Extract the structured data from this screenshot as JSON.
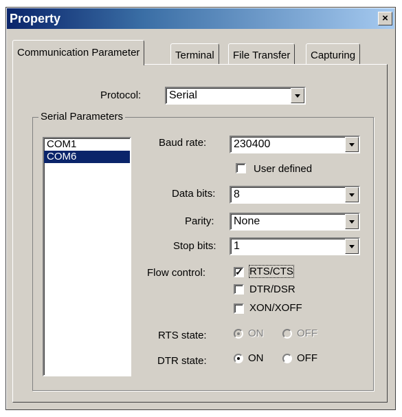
{
  "window": {
    "title": "Property",
    "close_glyph": "×"
  },
  "tabs": [
    {
      "label": "Communication Parameter",
      "active": true
    },
    {
      "label": "Terminal"
    },
    {
      "label": "File Transfer"
    },
    {
      "label": "Capturing"
    }
  ],
  "protocol": {
    "label": "Protocol:",
    "value": "Serial"
  },
  "serial_parameters": {
    "title": "Serial Parameters",
    "ports": [
      "COM1",
      "COM6"
    ],
    "selected_port": "COM6",
    "baud_rate": {
      "label": "Baud rate:",
      "value": "230400"
    },
    "user_defined": {
      "label": "User defined",
      "checked": false
    },
    "data_bits": {
      "label": "Data bits:",
      "value": "8"
    },
    "parity": {
      "label": "Parity:",
      "value": "None"
    },
    "stop_bits": {
      "label": "Stop bits:",
      "value": "1"
    },
    "flow_control": {
      "label": "Flow control:",
      "options": [
        {
          "label": "RTS/CTS",
          "checked": true
        },
        {
          "label": "DTR/DSR",
          "checked": false
        },
        {
          "label": "XON/XOFF",
          "checked": false
        }
      ]
    },
    "rts_state": {
      "label": "RTS state:",
      "on": "ON",
      "off": "OFF",
      "value": "ON",
      "enabled": false
    },
    "dtr_state": {
      "label": "DTR state:",
      "on": "ON",
      "off": "OFF",
      "value": "ON",
      "enabled": true
    }
  },
  "colors": {
    "titlebar_start": "#0a246a",
    "titlebar_end": "#a6caf0",
    "dialog_face": "#d4d0c8",
    "selection": "#0a246a"
  }
}
